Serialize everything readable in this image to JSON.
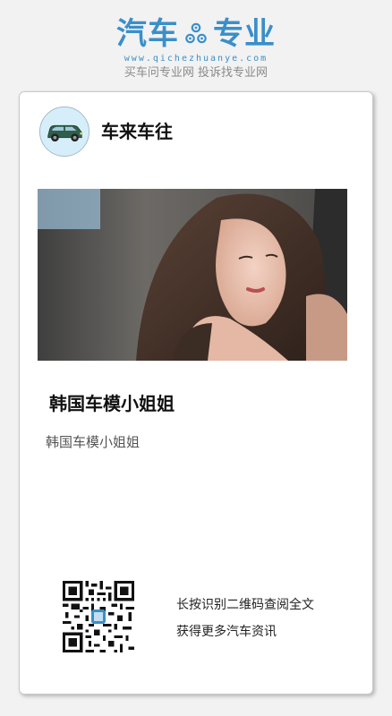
{
  "brand": {
    "left_word": "汽车",
    "right_word": "专业",
    "url": "www.qichezhuanye.com",
    "slogan": "买车问专业网 投诉找专业网",
    "accent_color": "#3a8fc9"
  },
  "account": {
    "name": "车来车往",
    "avatar_icon": "car-avatar-icon"
  },
  "article": {
    "title": "韩国车模小姐姐",
    "summary": "韩国车模小姐姐"
  },
  "qr": {
    "icon": "qr-code-icon",
    "line1": "长按识别二维码查阅全文",
    "line2": "获得更多汽车资讯"
  }
}
